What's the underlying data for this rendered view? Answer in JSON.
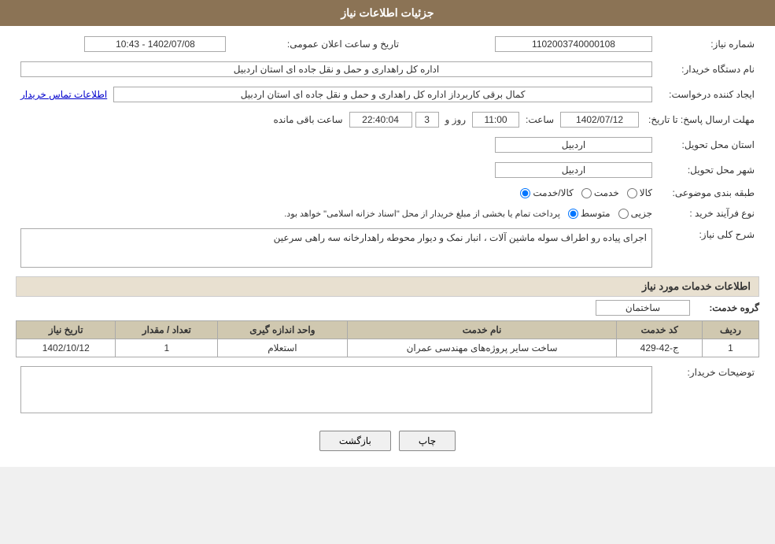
{
  "header": {
    "title": "جزئیات اطلاعات نیاز"
  },
  "fields": {
    "shomara_niaz_label": "شماره نیاز:",
    "shomara_niaz_value": "1102003740000108",
    "name_dastgah_label": "نام دستگاه خریدار:",
    "name_dastgah_value": "اداره کل راهداری و حمل و نقل جاده ای استان اردبیل",
    "ijad_konande_label": "ایجاد کننده درخواست:",
    "ijad_konande_value": "کمال برقی کاربرداز اداره کل راهداری و حمل و نقل جاده ای استان اردبیل",
    "etelaaat_link": "اطلاعات تماس خریدار",
    "mohlat_label": "مهلت ارسال پاسخ: تا تاریخ:",
    "tarikh_value": "1402/07/12",
    "saaat_label": "ساعت:",
    "saaat_value": "11:00",
    "rooz_label": "روز و",
    "rooz_value": "3",
    "mande_label": "ساعت باقی مانده",
    "mande_value": "22:40:04",
    "tarikh_saaat_elan_label": "تاریخ و ساعت اعلان عمومی:",
    "tarikh_saaat_elan_value": "1402/07/08 - 10:43",
    "ostan_tahvil_label": "استان محل تحویل:",
    "ostan_tahvil_value": "اردبیل",
    "shahr_tahvil_label": "شهر محل تحویل:",
    "shahr_tahvil_value": "اردبیل",
    "tabaqe_bandi_label": "طبقه بندی موضوعی:",
    "kala_label": "کالا",
    "khedmat_label": "خدمت",
    "kala_khedmat_label": "کالا/خدمت",
    "tabaqe_selected": "kala_khedmat",
    "noye_farayand_label": "نوع فرآیند خرید :",
    "jozii_label": "جزیی",
    "motavaset_label": "متوسط",
    "pardakht_text": "پرداخت تمام یا بخشی از مبلغ خریدار از محل \"اسناد خزانه اسلامی\" خواهد بود.",
    "noye_selected": "motavaset",
    "sharh_niaz_label": "شرح کلی نیاز:",
    "sharh_niaz_value": "اجرای پیاده رو اطراف سوله ماشین آلات ، انبار نمک و دیوار محوطه راهدارخانه سه راهی سرعین",
    "khadamat_label": "اطلاعات خدمات مورد نیاز",
    "goroh_khedmat_label": "گروه خدمت:",
    "goroh_khedmat_value": "ساختمان",
    "table": {
      "headers": [
        "ردیف",
        "کد خدمت",
        "نام خدمت",
        "واحد اندازه گیری",
        "تعداد / مقدار",
        "تاریخ نیاز"
      ],
      "rows": [
        {
          "radif": "1",
          "kod": "ج-42-429",
          "name": "ساخت سایر پروژه‌های مهندسی عمران",
          "vahed": "استعلام",
          "tedad": "1",
          "tarikh": "1402/10/12"
        }
      ]
    },
    "tosihaat_label": "توضیحات خریدار:",
    "tosihaat_value": ""
  },
  "buttons": {
    "chap_label": "چاپ",
    "bazgasht_label": "بازگشت"
  }
}
